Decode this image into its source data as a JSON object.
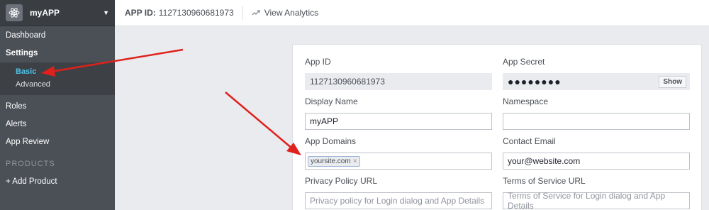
{
  "app": {
    "name": "myAPP",
    "icon": "atom-icon"
  },
  "topbar": {
    "app_id_label": "APP ID:",
    "app_id_value": "1127130960681973",
    "view_analytics": "View Analytics"
  },
  "sidebar": {
    "items": [
      {
        "label": "Dashboard"
      },
      {
        "label": "Settings"
      }
    ],
    "settings_sub": [
      {
        "label": "Basic"
      },
      {
        "label": "Advanced"
      }
    ],
    "items_after": [
      {
        "label": "Roles"
      },
      {
        "label": "Alerts"
      },
      {
        "label": "App Review"
      }
    ],
    "products_header": "PRODUCTS",
    "add_product": "+ Add Product"
  },
  "form": {
    "app_id": {
      "label": "App ID",
      "value": "1127130960681973"
    },
    "app_secret": {
      "label": "App Secret",
      "value": "●●●●●●●●",
      "show_label": "Show"
    },
    "display_name": {
      "label": "Display Name",
      "value": "myAPP"
    },
    "namespace": {
      "label": "Namespace",
      "value": ""
    },
    "app_domains": {
      "label": "App Domains",
      "tag": "yoursite.com",
      "tag_remove": "×"
    },
    "contact_email": {
      "label": "Contact Email",
      "value": "your@website.com"
    },
    "privacy_policy_url": {
      "label": "Privacy Policy URL",
      "placeholder": "Privacy policy for Login dialog and App Details"
    },
    "terms_of_service_url": {
      "label": "Terms of Service URL",
      "placeholder": "Terms of Service for Login dialog and App Details"
    }
  },
  "colors": {
    "sidebar_bg": "#4b4f56",
    "active_sub": "#4fc3e8",
    "arrow": "#e0201c"
  }
}
